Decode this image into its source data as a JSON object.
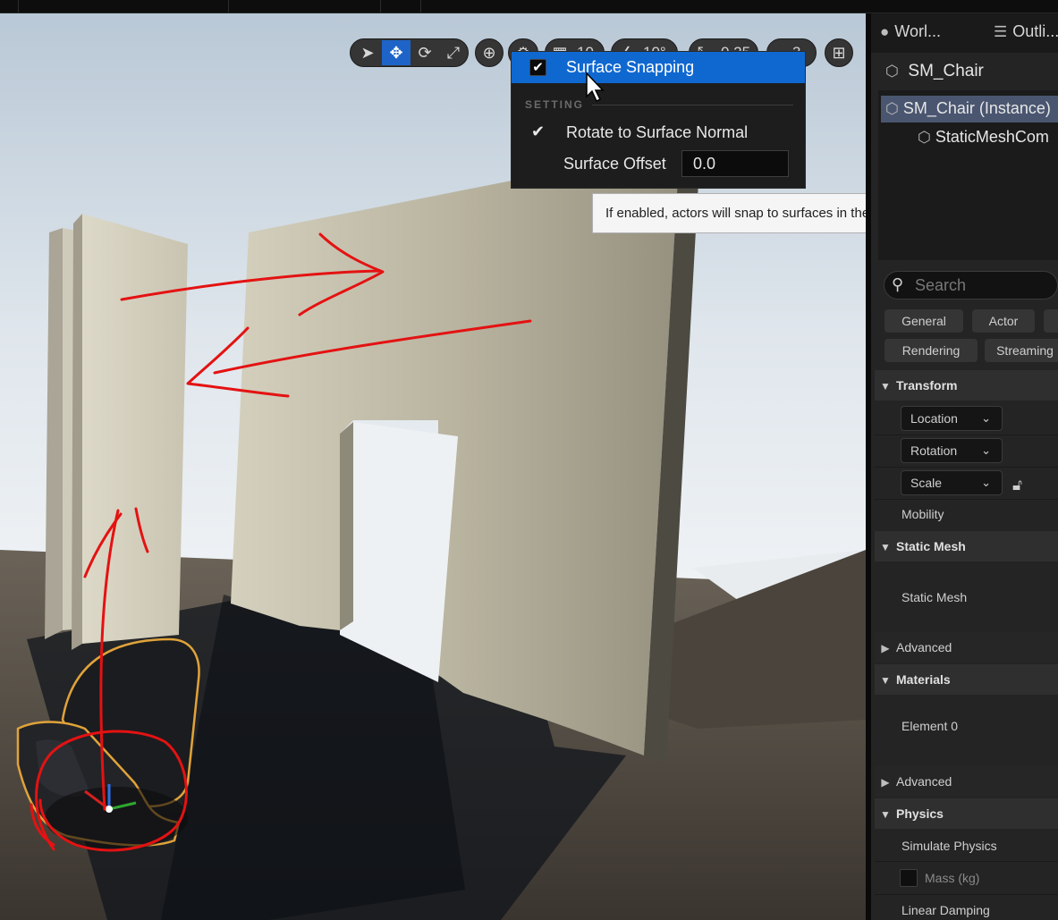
{
  "toolbar": {
    "grid_snap_value": "10",
    "rotation_snap_value": "10°",
    "scale_snap_value": "0.25",
    "camera_speed_value": "3"
  },
  "snap_menu": {
    "surface_snapping_label": "Surface Snapping",
    "surface_snapping_checked": true,
    "settings_header": "SETTING",
    "rotate_to_normal_label": "Rotate to Surface Normal",
    "rotate_to_normal_checked": true,
    "surface_offset_label": "Surface Offset",
    "surface_offset_value": "0.0"
  },
  "tooltip": {
    "text": "If enabled, actors will snap to surfaces in the world when dragging"
  },
  "panel": {
    "tabs": [
      "Worl...",
      "Outli..."
    ],
    "actor_name": "SM_Chair",
    "components": [
      "SM_Chair (Instance)",
      "StaticMeshCom"
    ],
    "search_placeholder": "Search",
    "filters": [
      "General",
      "Actor",
      "Rendering",
      "Streaming"
    ],
    "sections": {
      "transform": "Transform",
      "static_mesh": "Static Mesh",
      "materials": "Materials",
      "physics": "Physics"
    },
    "transform": {
      "location": "Location",
      "rotation": "Rotation",
      "scale": "Scale",
      "mobility": "Mobility"
    },
    "static_mesh_prop": "Static Mesh",
    "advanced": "Advanced",
    "element0": "Element 0",
    "physics": {
      "simulate": "Simulate Physics",
      "mass": "Mass (kg)",
      "linear_damping": "Linear Damping"
    }
  },
  "colors": {
    "selection_blue": "#0f68d0",
    "annotation_red": "#e41212",
    "panel_bg": "#242424"
  }
}
